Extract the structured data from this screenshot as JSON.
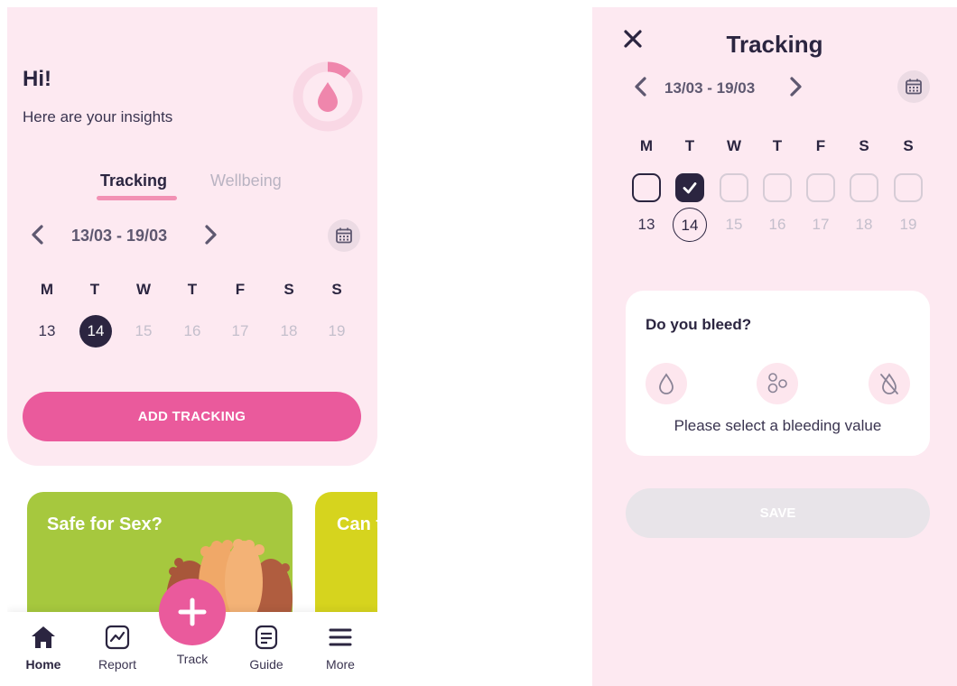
{
  "left": {
    "greeting": "Hi!",
    "subtitle": "Here are your insights",
    "tabs": [
      {
        "label": "Tracking",
        "active": true
      },
      {
        "label": "Wellbeing",
        "active": false
      }
    ],
    "week_range": "13/03 - 19/03",
    "day_names": [
      "M",
      "T",
      "W",
      "T",
      "F",
      "S",
      "S"
    ],
    "day_numbers": [
      "13",
      "14",
      "15",
      "16",
      "17",
      "18",
      "19"
    ],
    "selected_day": "14",
    "add_button": "ADD TRACKING",
    "promos": [
      {
        "title": "Safe for Sex?"
      },
      {
        "title": "Can tamp"
      }
    ],
    "nav": [
      {
        "label": "Home",
        "icon": "home-icon",
        "active": true
      },
      {
        "label": "Report",
        "icon": "chart-icon",
        "active": false
      },
      {
        "label": "Track",
        "icon": "plus-icon",
        "active": false
      },
      {
        "label": "Guide",
        "icon": "document-icon",
        "active": false
      },
      {
        "label": "More",
        "icon": "menu-icon",
        "active": false
      }
    ]
  },
  "right": {
    "title": "Tracking",
    "week_range": "13/03 - 19/03",
    "day_names": [
      "M",
      "T",
      "W",
      "T",
      "F",
      "S",
      "S"
    ],
    "day_numbers": [
      "13",
      "14",
      "15",
      "16",
      "17",
      "18",
      "19"
    ],
    "checked_day": "14",
    "question": "Do you bleed?",
    "bleeding_options": [
      "drop-icon",
      "spotting-icon",
      "no-bleeding-icon"
    ],
    "hint": "Please select a bleeding value",
    "save_button": "SAVE"
  },
  "colors": {
    "accent": "#ea5a9c",
    "card_bg": "#fde9f1",
    "dark": "#2b2540",
    "muted": "#c4bfcc",
    "promo_green": "#a6c83e",
    "promo_yellow": "#d6d41e"
  }
}
